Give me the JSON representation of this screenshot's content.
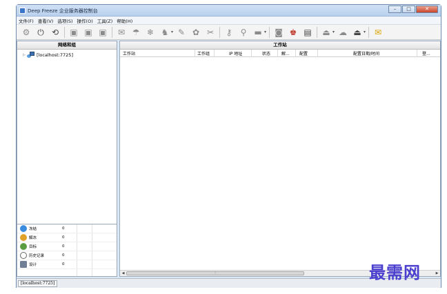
{
  "window": {
    "title": "Deep Freeze 企业服务器控制台",
    "controls": {
      "minimize": "–",
      "maximize": "□",
      "close": "✕"
    }
  },
  "menu": [
    "文件(F)",
    "查看(V)",
    "选项(S)",
    "操作(O)",
    "工具(Z)",
    "帮助(H)"
  ],
  "toolbar_icons": [
    "settings-icon",
    "power-icon",
    "reboot-icon",
    "workstation-icon",
    "workstation-icon",
    "workstation-icon",
    "message-icon",
    "thaw-icon",
    "freeze-icon",
    "users-icon",
    "wrench-icon",
    "update-icon",
    "install-icon",
    "key-icon",
    "remote-icon",
    "drive-icon",
    "scan-icon",
    "add-user-icon",
    "schedule-icon",
    "upload-icon",
    "network-icon",
    "export-icon",
    "notification-icon"
  ],
  "left_panel": {
    "header": "网络和组",
    "tree": [
      {
        "label": "[localhost:7725]"
      }
    ],
    "status_items": [
      {
        "label": "冻结",
        "count": "0",
        "color": "#3a8cde"
      },
      {
        "label": "解冻",
        "count": "0",
        "color": "#e0a12b"
      },
      {
        "label": "目标",
        "count": "0",
        "color": "#5b9c43"
      },
      {
        "label": "历史记录",
        "count": "0",
        "color": "#8a8a8a"
      },
      {
        "label": "设计",
        "count": "0",
        "color": "#6f7e95"
      }
    ]
  },
  "right_panel": {
    "header": "工作站",
    "columns": [
      "工作站",
      "工作组",
      "IP 地址",
      "状态",
      "解...",
      "配置",
      "配置日期/时间",
      "登..."
    ],
    "rows": []
  },
  "statusbar": {
    "host": "[localhost:7725]"
  },
  "watermark": "最需网"
}
